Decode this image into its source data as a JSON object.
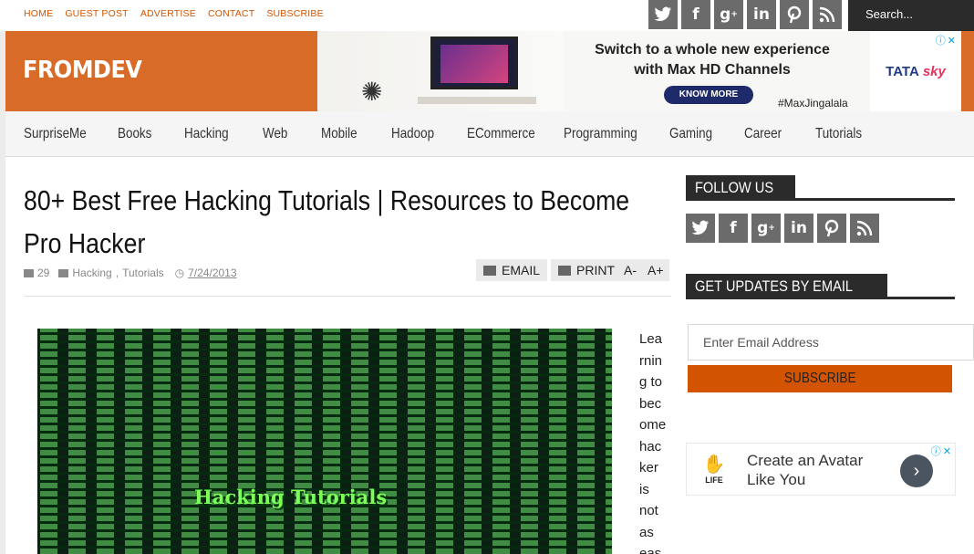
{
  "topbar": {
    "links": [
      "HOME",
      "GUEST POST",
      "ADVERTISE",
      "CONTACT",
      "SUBSCRIBE"
    ],
    "social_icons": [
      "twitter-icon",
      "facebook-icon",
      "google-plus-icon",
      "linkedin-icon",
      "pinterest-icon",
      "rss-icon"
    ],
    "search_placeholder": "Search..."
  },
  "header": {
    "logo": "FROMDEV",
    "ad": {
      "headline_1": "Switch to a whole new experience",
      "headline_2": "with Max HD Channels",
      "cta": "KNOW MORE",
      "hashtag": "#MaxJingalala",
      "brand_1": "TATA",
      "brand_2": "sky"
    }
  },
  "nav": {
    "items": [
      "SurpriseMe",
      "Books",
      "Hacking",
      "Web",
      "Mobile",
      "Hadoop",
      "ECommerce",
      "Programming",
      "Gaming",
      "Career",
      "Tutorials"
    ]
  },
  "article": {
    "title": "80+ Best Free Hacking Tutorials | Resources to Become Pro Hacker",
    "comments": "29",
    "cat_1": "Hacking",
    "cat_sep": ", ",
    "cat_2": "Tutorials",
    "date": "7/24/2013",
    "email_label": "EMAIL",
    "print_label": "PRINT",
    "font_smaller": "A-",
    "font_larger": "A+",
    "image_caption": "Hacking Tutorials",
    "body_lines": [
      "Lea",
      "rnin",
      "g to",
      "bec",
      "ome",
      "hac",
      "ker",
      "is",
      "not",
      "as",
      "eas"
    ]
  },
  "sidebar": {
    "follow_title": "FOLLOW US",
    "updates_title": "GET UPDATES BY EMAIL",
    "email_placeholder": "Enter Email Address",
    "subscribe_label": "SUBSCRIBE",
    "ad": {
      "logo_text": "LIFE",
      "line_1": "Create an Avatar",
      "line_2": "Like You"
    }
  }
}
